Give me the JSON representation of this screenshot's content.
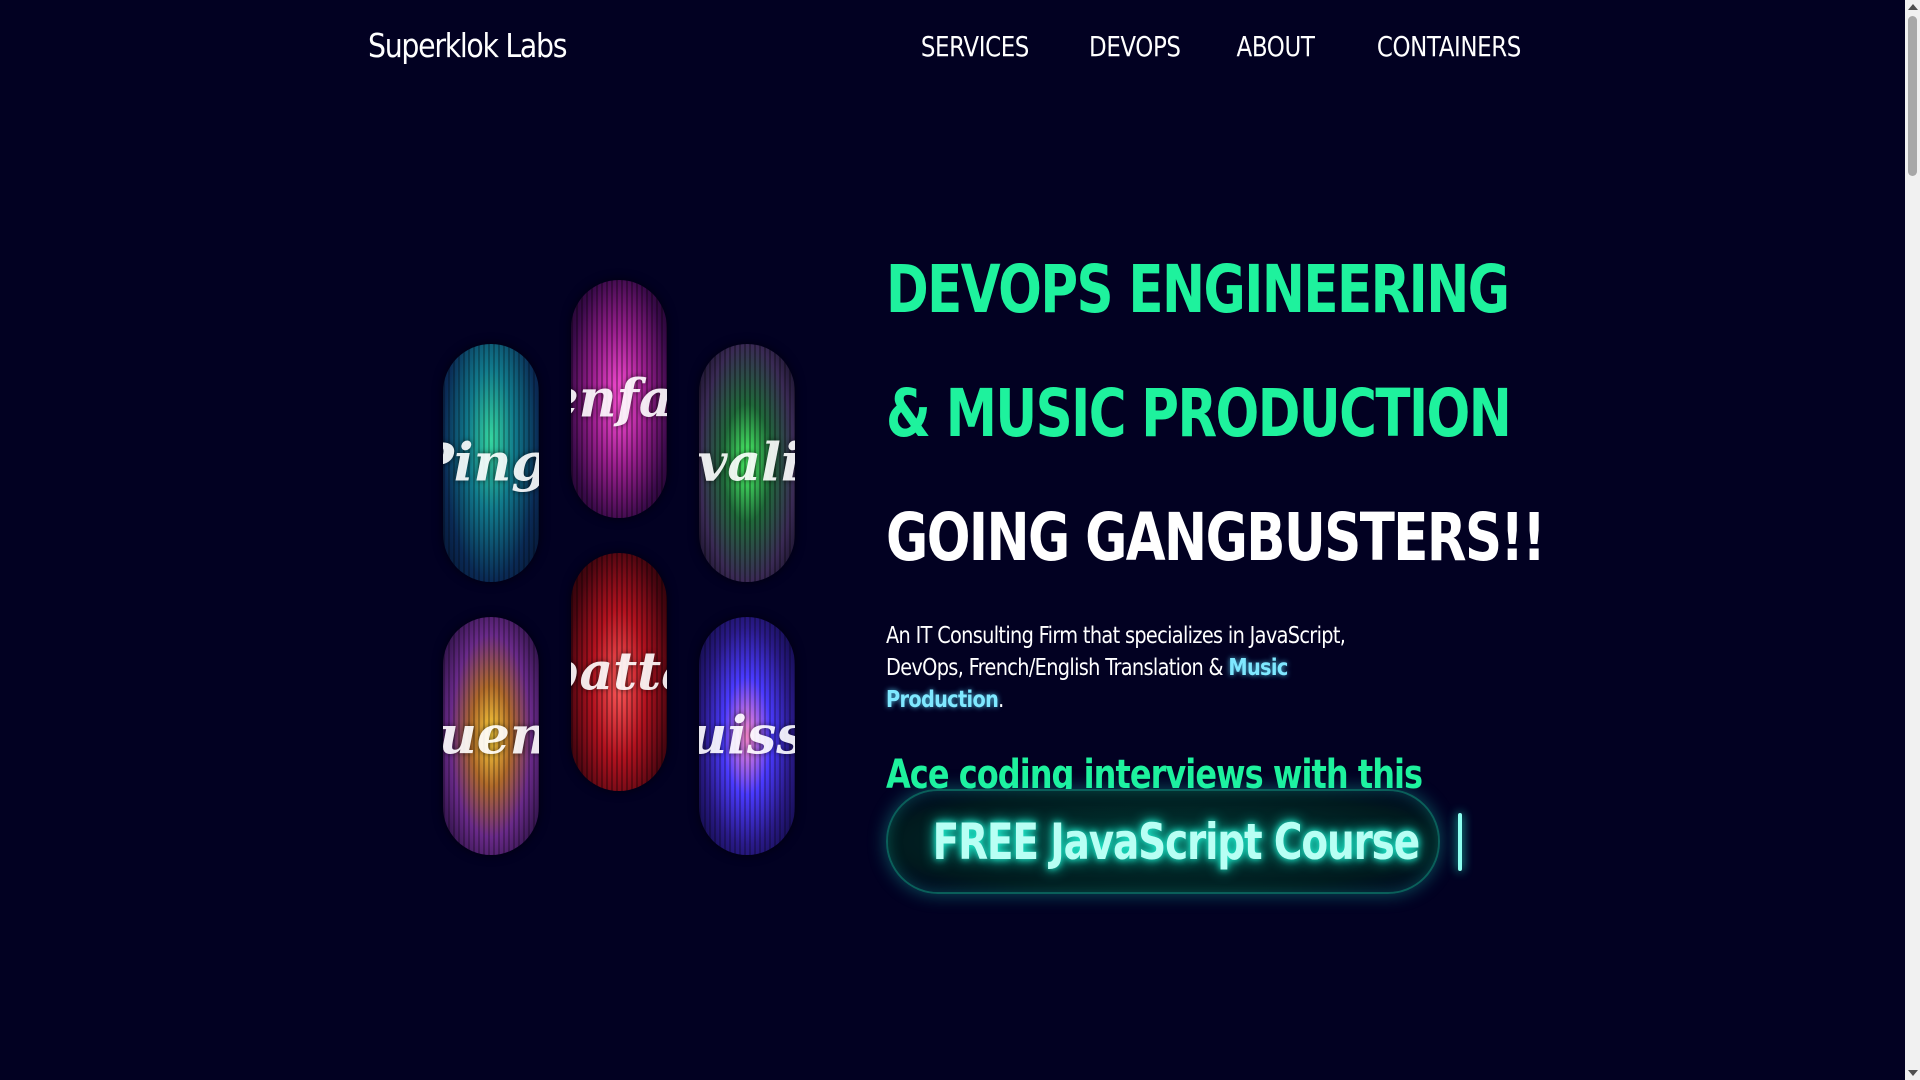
{
  "header": {
    "brand": "Superklok Labs",
    "nav": [
      "SERVICES",
      "DEVOPS",
      "ABOUT",
      "CONTAINERS"
    ]
  },
  "gallery": {
    "pills": [
      {
        "word": "Pingl",
        "color": "#35d6a0"
      },
      {
        "word": "enfai",
        "color": "#ff4fd8"
      },
      {
        "word": "évalis",
        "color": "#4cff6a"
      },
      {
        "word": "quenc",
        "color": "#ffd23a"
      },
      {
        "word": "batta",
        "color": "#ff5a5a"
      },
      {
        "word": "ouissa",
        "color": "#4a3aff"
      }
    ]
  },
  "hero": {
    "headline_line1": "DEVOPS ENGINEERING",
    "headline_line2": "& MUSIC PRODUCTION",
    "headline_line3": "GOING GANGBUSTERS!!",
    "tagline_prefix": "An IT Consulting Firm that specializes in JavaScript, DevOps, French/English Translation & ",
    "tagline_link": "Music Production",
    "tagline_suffix": ".",
    "subhead": "Ace coding interviews with this",
    "cta_label": "FREE JavaScript Course",
    "cta_icon": "course-thumbnail-icon"
  },
  "colors": {
    "background": "#020122",
    "accent_green": "#1ef29d",
    "link_cyan": "#7fe8ff",
    "cta_glow": "#1ef2d2"
  }
}
